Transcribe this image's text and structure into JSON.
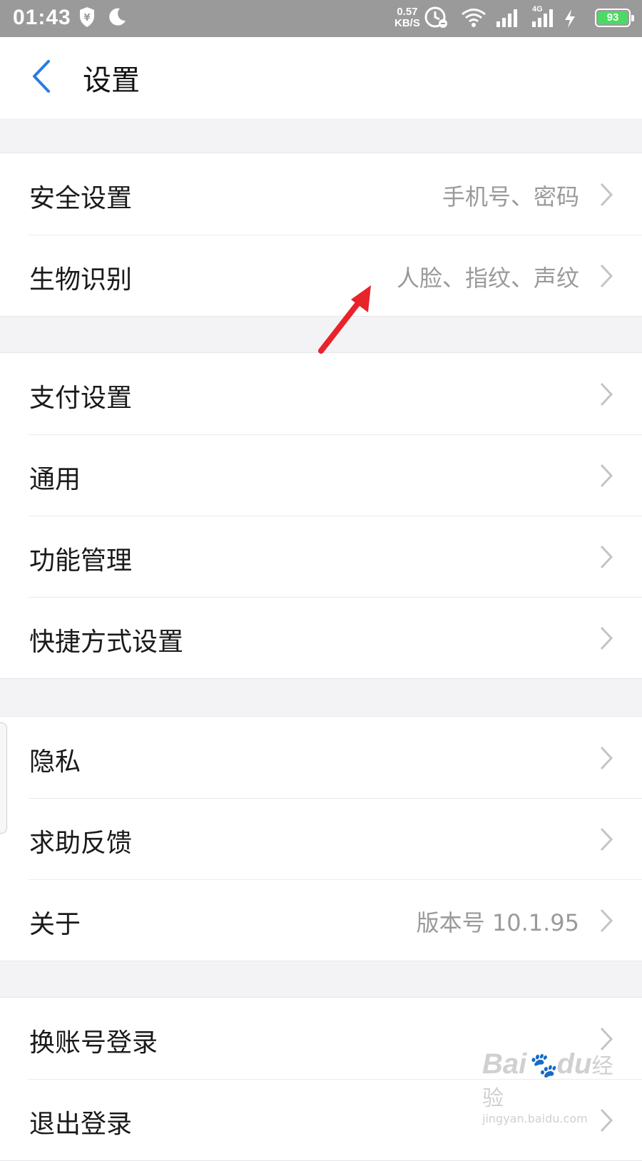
{
  "status_bar": {
    "time": "01:43",
    "speed_value": "0.57",
    "speed_unit": "KB/S",
    "network": "4G",
    "battery": "93",
    "icons": [
      "vpn-shield-icon",
      "moon-icon",
      "alarm-icon",
      "wifi-icon",
      "signal-icon",
      "signal-4g-icon",
      "charging-icon",
      "battery-icon"
    ]
  },
  "header": {
    "title": "设置",
    "back_icon": "chevron-left-icon"
  },
  "groups": [
    {
      "items": [
        {
          "label": "安全设置",
          "value": "手机号、密码"
        },
        {
          "label": "生物识别",
          "value": "人脸、指纹、声纹"
        }
      ]
    },
    {
      "items": [
        {
          "label": "支付设置",
          "value": ""
        },
        {
          "label": "通用",
          "value": ""
        },
        {
          "label": "功能管理",
          "value": ""
        },
        {
          "label": "快捷方式设置",
          "value": ""
        }
      ]
    },
    {
      "items": [
        {
          "label": "隐私",
          "value": ""
        },
        {
          "label": "求助反馈",
          "value": ""
        },
        {
          "label": "关于",
          "value": "版本号 10.1.95"
        }
      ]
    },
    {
      "items": [
        {
          "label": "换账号登录",
          "value": ""
        },
        {
          "label": "退出登录",
          "value": ""
        }
      ]
    }
  ],
  "colors": {
    "accent": "#2a7de1",
    "annotation_arrow": "#e8232a",
    "status_bar_bg": "#9a9a9a",
    "battery": "#4cd964"
  },
  "watermark": {
    "logo_text": "Bai",
    "logo_suffix": "du",
    "label": "经验",
    "url": "jingyan.baidu.com"
  }
}
